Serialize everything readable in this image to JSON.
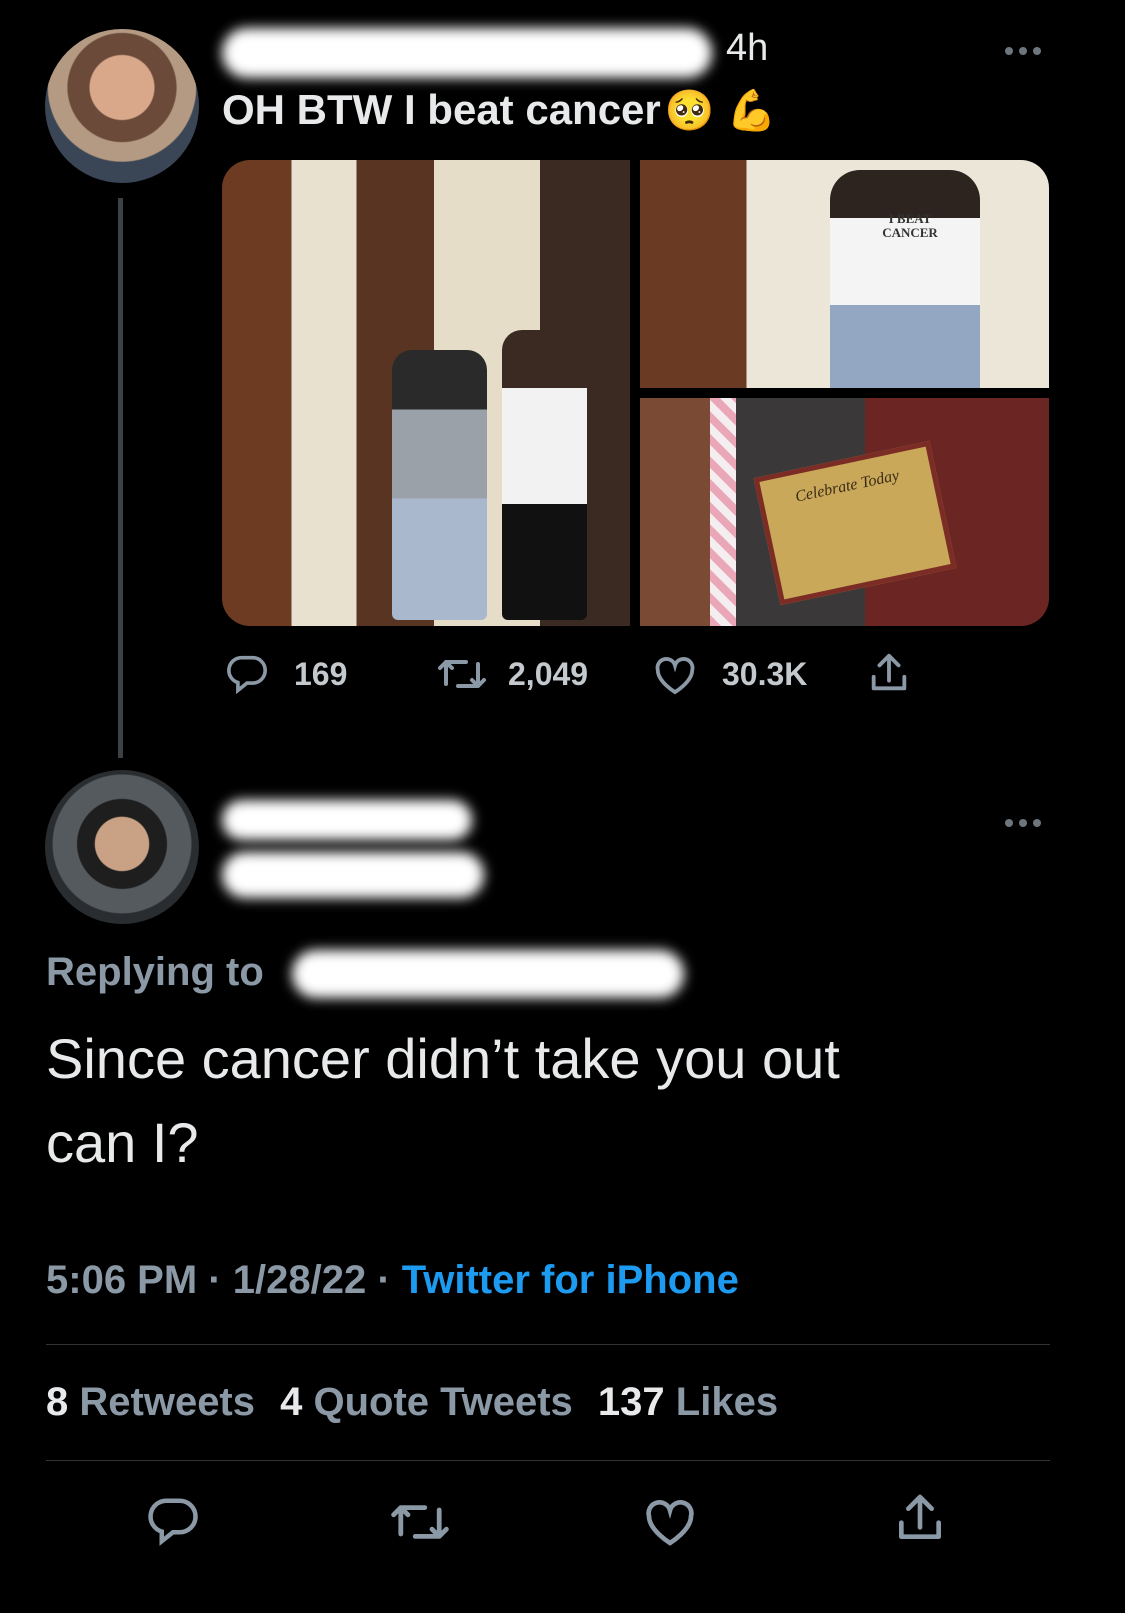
{
  "parent_tweet": {
    "time": "4h",
    "text": "OH BTW I beat cancer",
    "emoji_1": "🥺",
    "emoji_2": "💪",
    "photo_shirt_text": "I BEAT CANCER",
    "plaque_title": "Celebrate Today",
    "actions": {
      "replies": "169",
      "retweets": "2,049",
      "likes": "30.3K"
    }
  },
  "reply_tweet": {
    "replying_label": "Replying to",
    "text_line1": "Since cancer didn’t take you out",
    "text_line2": "can I?",
    "time": "5:06 PM",
    "sep1": "·",
    "date": "1/28/22",
    "sep2": "·",
    "source": "Twitter for iPhone",
    "stats": {
      "retweets_count": "8",
      "retweets_label": "Retweets",
      "quotes_count": "4",
      "quotes_label": "Quote Tweets",
      "likes_count": "137",
      "likes_label": "Likes"
    }
  },
  "colors": {
    "background": "#000000",
    "text": "#e7e9ea",
    "secondary": "#8b98a5",
    "link": "#1d9bf0",
    "divider": "#2f3336"
  },
  "icons": [
    "reply-icon",
    "retweet-icon",
    "like-icon",
    "share-icon",
    "more-icon"
  ]
}
